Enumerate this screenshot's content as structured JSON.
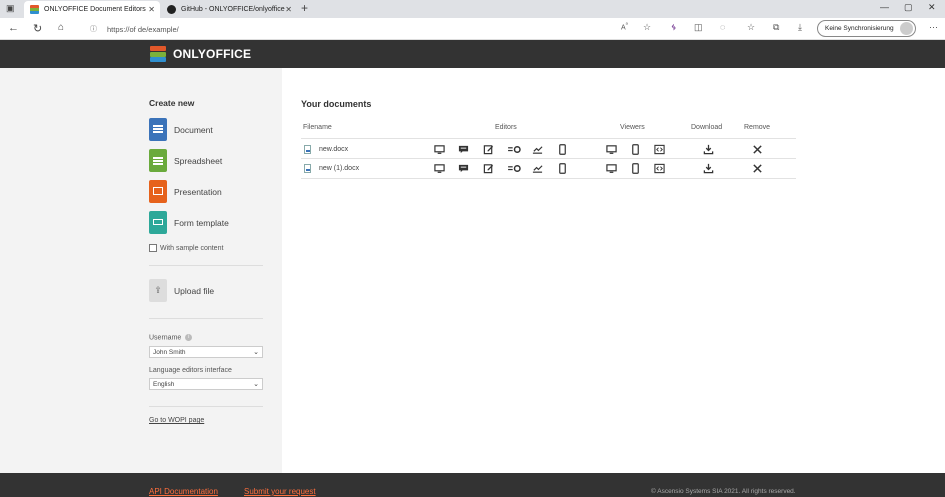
{
  "browser": {
    "tabs": [
      {
        "title": "ONLYOFFICE Document Editors",
        "active": true
      },
      {
        "title": "GitHub - ONLYOFFICE/onlyoffice",
        "active": false
      }
    ],
    "url": "https://of                         de/example/",
    "sync_label": "Keine Synchronisierung"
  },
  "header": {
    "logo_text": "ONLYOFFICE"
  },
  "sidebar": {
    "create_title": "Create new",
    "create_items": [
      {
        "label": "Document",
        "color": "#3b73b9"
      },
      {
        "label": "Spreadsheet",
        "color": "#6aaa3c"
      },
      {
        "label": "Presentation",
        "color": "#e6621c"
      },
      {
        "label": "Form template",
        "color": "#2da899"
      }
    ],
    "sample_label": "With sample content",
    "upload_label": "Upload file",
    "username_label": "Username",
    "username_value": "John Smith",
    "language_label": "Language editors interface",
    "language_value": "English",
    "wopi_link": "Go to WOPI page"
  },
  "main": {
    "title": "Your documents",
    "columns": {
      "filename": "Filename",
      "editors": "Editors",
      "viewers": "Viewers",
      "download": "Download",
      "remove": "Remove"
    },
    "files": [
      {
        "name": "new.docx"
      },
      {
        "name": "new (1).docx"
      }
    ]
  },
  "footer": {
    "api_link": "API Documentation",
    "submit_link": "Submit your request",
    "copyright": "© Ascensio Systems SIA 2021. All rights reserved."
  },
  "colors": {
    "header_bg": "#333333",
    "footer_link": "#ff6f3d",
    "sidebar_bg": "#f3f3f3"
  }
}
